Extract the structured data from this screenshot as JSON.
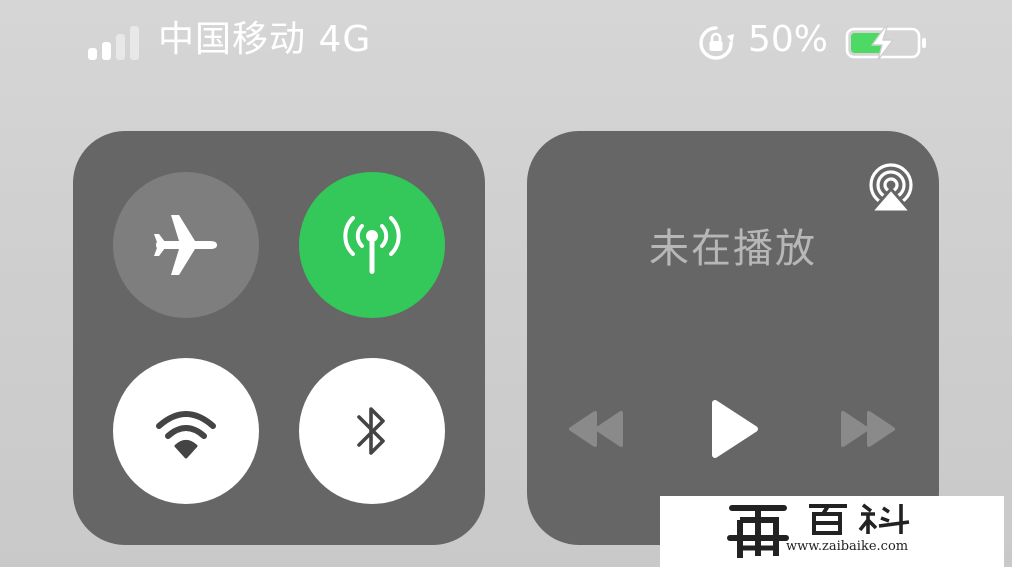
{
  "status_bar": {
    "carrier": "中国移动 4G",
    "battery_percent": "50%",
    "battery_level": 0.5,
    "battery_charging": true,
    "signal_bars_active": 2,
    "signal_bars_total": 4,
    "icons": {
      "signal": "cellular-signal-icon",
      "rotation_lock": "rotation-lock-icon",
      "battery": "battery-charging-icon"
    }
  },
  "connectivity": {
    "airplane_mode": {
      "icon": "airplane-icon",
      "active": false
    },
    "cellular_data": {
      "icon": "cellular-antenna-icon",
      "active": true
    },
    "wifi": {
      "icon": "wifi-icon",
      "active": true
    },
    "bluetooth": {
      "icon": "bluetooth-icon",
      "active": true
    }
  },
  "now_playing": {
    "status_text": "未在播放",
    "airplay_icon": "airplay-icon",
    "controls": [
      "rewind-icon",
      "play-icon",
      "fast-forward-icon"
    ]
  },
  "watermark": {
    "url": "www.zaibaike.com",
    "logo_text": "再百科"
  },
  "colors": {
    "panel": "#666666",
    "active_green": "#34c759",
    "inactive_toggle": "#7e7e7e",
    "active_white": "#ffffff",
    "dim_text": "#b7b7b7",
    "battery_green": "#4cd964"
  }
}
